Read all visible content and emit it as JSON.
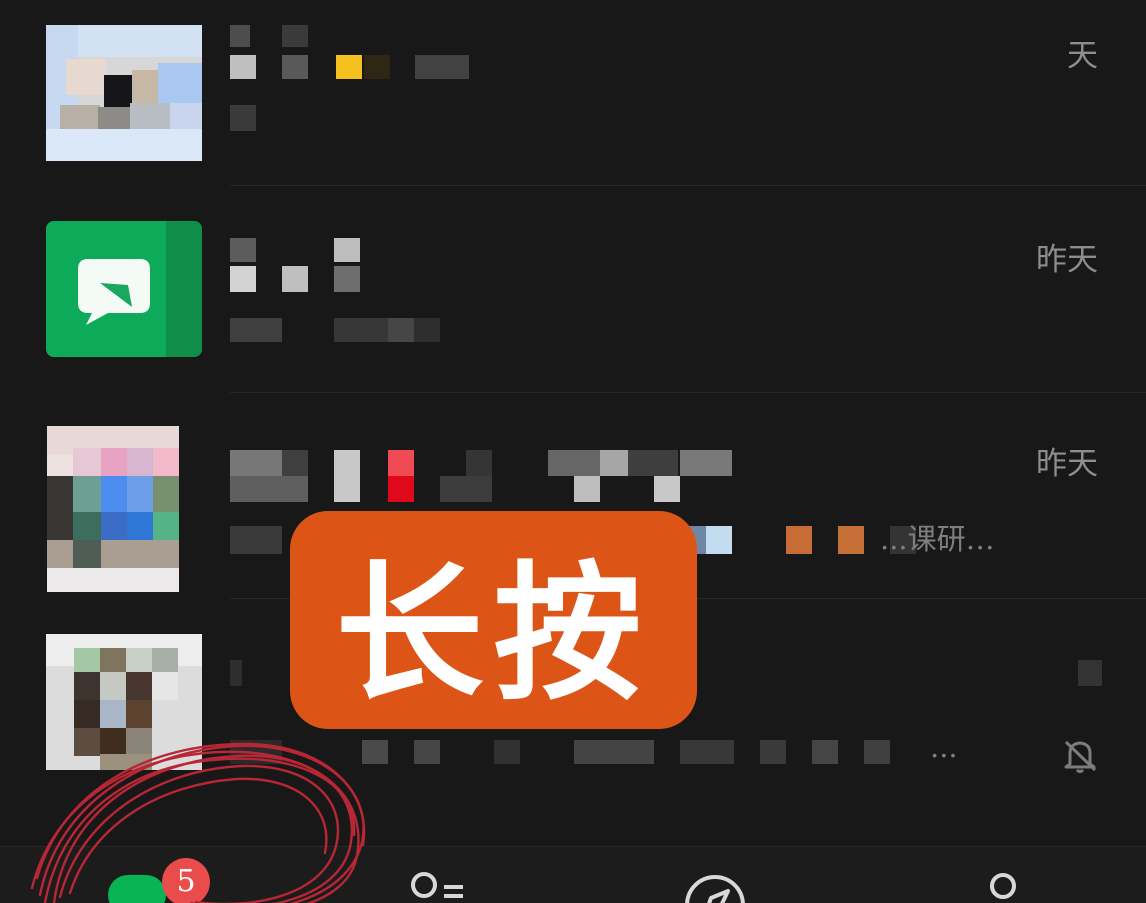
{
  "chat_list": [
    {
      "avatar": "pixelated-avatar",
      "name": "",
      "preview": "",
      "time": "天"
    },
    {
      "avatar": "green-message-avatar",
      "name": "",
      "preview": "",
      "time": "昨天"
    },
    {
      "avatar": "pixelated-avatar",
      "name": "",
      "preview": "...课研…",
      "time": "昨天"
    },
    {
      "avatar": "pixelated-avatar",
      "name": "",
      "preview": "...",
      "time": "",
      "muted": true
    }
  ],
  "overlay": {
    "label": "长按"
  },
  "tab_bar": {
    "chats": {
      "unread_count": "5"
    }
  },
  "colors": {
    "background": "#181818",
    "overlay_orange": "#dd5516",
    "badge_red": "#ea4b4b",
    "active_green": "#08b454",
    "scribble_red": "#b72735"
  },
  "icons": [
    "green-message-icon",
    "bell-mute-icon",
    "chat-tab-icon",
    "contacts-tab-icon",
    "discover-compass-icon",
    "me-tab-icon"
  ]
}
